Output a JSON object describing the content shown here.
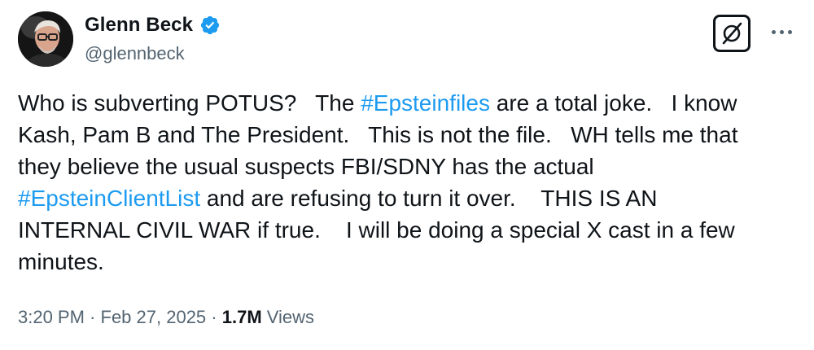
{
  "author": {
    "display_name": "Glenn Beck",
    "handle": "@glennbeck",
    "verified": true,
    "verified_color": "#1d9bf0"
  },
  "header_actions": {
    "grok_icon": "slashed-circle-icon",
    "more_icon": "more-dots-icon"
  },
  "tweet": {
    "lines": [
      {
        "segments": [
          {
            "text": "Who is subverting POTUS?   The ",
            "type": "text"
          },
          {
            "text": "#Epsteinfiles",
            "type": "hashtag"
          },
          {
            "text": " are a total joke.   I know",
            "type": "text"
          }
        ]
      },
      {
        "segments": [
          {
            "text": "Kash, Pam B and The President.   This is not the file.   WH tells me that",
            "type": "text"
          }
        ]
      },
      {
        "segments": [
          {
            "text": "they believe the usual suspects FBI/SDNY has the actual",
            "type": "text"
          }
        ]
      },
      {
        "segments": [
          {
            "text": "#EpsteinClientList",
            "type": "hashtag"
          },
          {
            "text": " and are refusing to turn it over.    THIS IS AN",
            "type": "text"
          }
        ]
      },
      {
        "segments": [
          {
            "text": "INTERNAL CIVIL WAR if true.    I will be doing a special X cast in a few",
            "type": "text"
          }
        ]
      },
      {
        "segments": [
          {
            "text": "minutes.",
            "type": "text"
          }
        ]
      }
    ],
    "hashtag_color": "#1d9bf0"
  },
  "meta": {
    "time": "3:20 PM",
    "separator": " · ",
    "date": "Feb 27, 2025",
    "views_count": "1.7M",
    "views_label": " Views"
  }
}
